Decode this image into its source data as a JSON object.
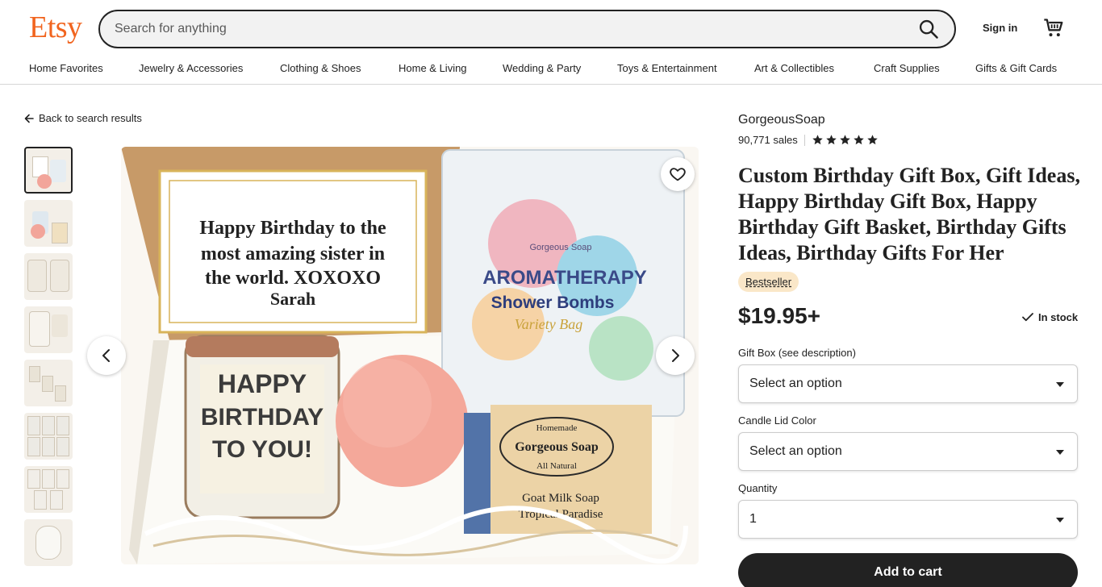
{
  "header": {
    "logo": "Etsy",
    "search_placeholder": "Search for anything",
    "sign_in": "Sign in",
    "icons": {
      "search": "search-icon",
      "cart": "cart-icon"
    }
  },
  "categories": [
    "Home Favorites",
    "Jewelry & Accessories",
    "Clothing & Shoes",
    "Home & Living",
    "Wedding & Party",
    "Toys & Entertainment",
    "Art & Collectibles",
    "Craft Supplies",
    "Gifts & Gift Cards"
  ],
  "back_link": "Back to search results",
  "gallery": {
    "thumbnail_count": 8,
    "active_index": 0,
    "image_text": {
      "card": "Happy Birthday to the most amazing sister in the world. XOXOXO Sarah",
      "candle": "HAPPY BIRTHDAY TO YOU!",
      "bag_line1": "Gorgeous Soap",
      "bag_line2": "AROMATHERAPY",
      "bag_line3": "Shower Bombs",
      "bag_line4": "Variety Bag",
      "soap_line1": "Homemade",
      "soap_line2": "Gorgeous Soap",
      "soap_line3": "All Natural",
      "soap_line4": "Goat Milk Soap",
      "soap_line5": "Tropical Paradise"
    }
  },
  "product": {
    "shop_name": "GorgeousSoap",
    "sales": "90,771 sales",
    "rating": 5,
    "title": "Custom Birthday Gift Box, Gift Ideas, Happy Birthday Gift Box, Happy Birthday Gift Basket, Birthday Gifts Ideas, Birthday Gifts For Her",
    "badge": "Bestseller",
    "price": "$19.95+",
    "stock": "In stock",
    "options": [
      {
        "label": "Gift Box (see description)",
        "value": "Select an option"
      },
      {
        "label": "Candle Lid Color",
        "value": "Select an option"
      },
      {
        "label": "Quantity",
        "value": "1"
      }
    ],
    "add_to_cart": "Add to cart"
  },
  "colors": {
    "brand": "#f1641e",
    "text": "#222222",
    "badge_bg": "#fae7c8",
    "button_bg": "#222222"
  }
}
